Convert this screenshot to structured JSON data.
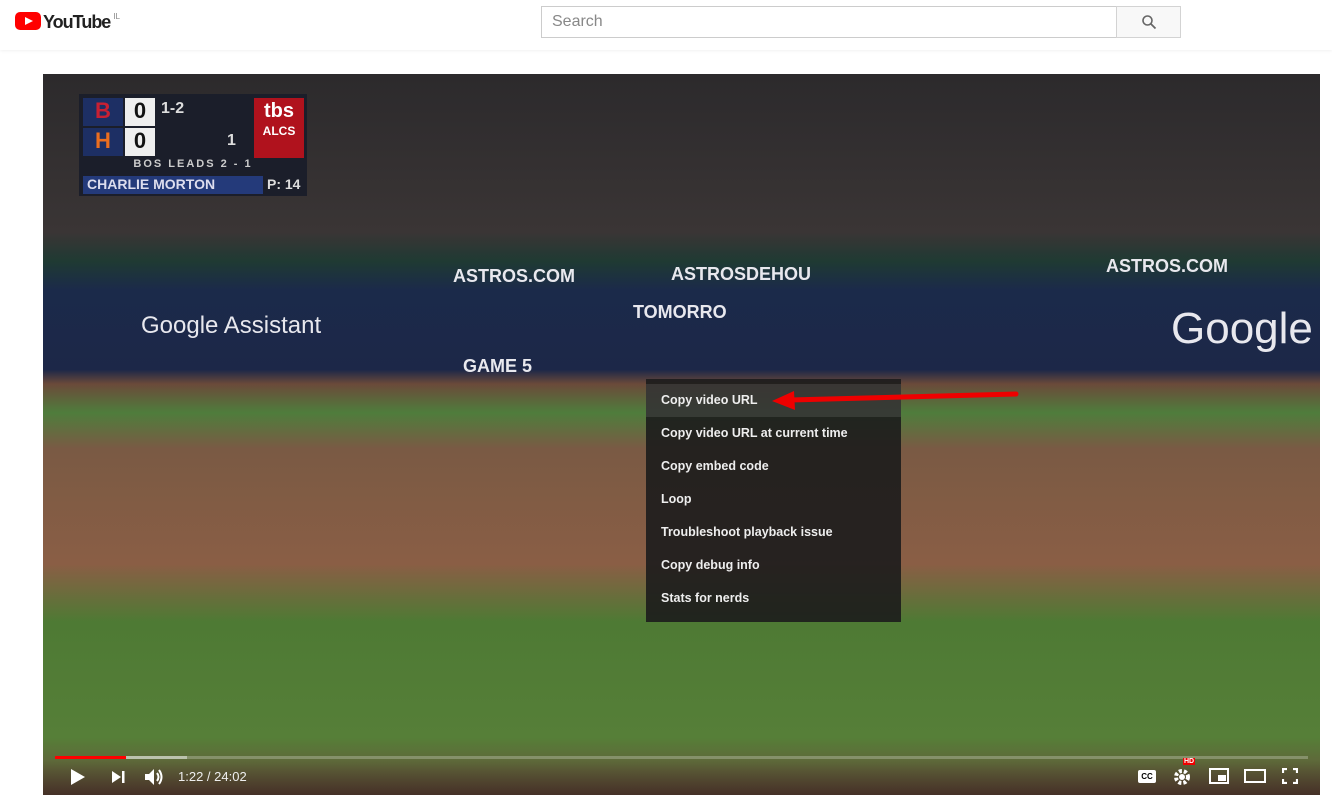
{
  "header": {
    "logo_text": "YouTube",
    "country_code": "IL",
    "search_placeholder": "Search"
  },
  "video": {
    "scoreboard": {
      "away_team": "B",
      "home_team": "H",
      "away_score": "0",
      "home_score": "0",
      "count": "1-2",
      "outs": "1",
      "network": "tbs",
      "series": "ALCS",
      "lead_text": "BOS LEADS 2 - 1",
      "pitcher": "CHARLIE MORTON",
      "pitch_count": "P: 14"
    },
    "ads": [
      "Google Assistant",
      "ASTROS.COM",
      "ASTROSDEHOU",
      "TOMORRO",
      "GAME 5",
      "ASTROS.COM",
      "Google"
    ]
  },
  "context_menu": {
    "items": [
      "Copy video URL",
      "Copy video URL at current time",
      "Copy embed code",
      "Loop",
      "Troubleshoot playback issue",
      "Copy debug info",
      "Stats for nerds"
    ],
    "highlighted_index": 0
  },
  "player": {
    "current_time": "1:22",
    "duration": "24:02",
    "time_display": "1:22 / 24:02",
    "progress_fraction": 0.057,
    "buffered_fraction": 0.105,
    "hd_badge": "HD",
    "cc_label": "CC"
  },
  "colors": {
    "brand": "#ff0000",
    "annotation_arrow": "#e00000"
  }
}
